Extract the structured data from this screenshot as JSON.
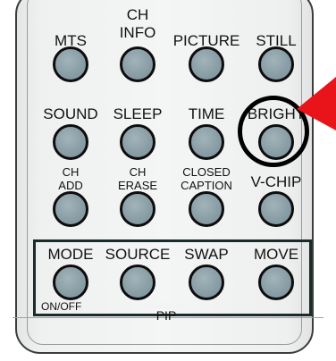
{
  "rows": [
    {
      "buttons": [
        {
          "lines": [
            "MTS"
          ]
        },
        {
          "lines": [
            "CH",
            "INFO"
          ]
        },
        {
          "lines": [
            "PICTURE"
          ]
        },
        {
          "lines": [
            "STILL"
          ]
        }
      ]
    },
    {
      "buttons": [
        {
          "lines": [
            "SOUND"
          ]
        },
        {
          "lines": [
            "SLEEP"
          ]
        },
        {
          "lines": [
            "TIME"
          ]
        },
        {
          "lines": [
            "BRIGHT"
          ]
        }
      ]
    },
    {
      "buttons": [
        {
          "lines": [
            "CH",
            "ADD"
          ]
        },
        {
          "lines": [
            "CH",
            "ERASE"
          ]
        },
        {
          "lines": [
            "CLOSED",
            "CAPTION"
          ]
        },
        {
          "lines": [
            "V-CHIP"
          ]
        }
      ]
    },
    {
      "buttons": [
        {
          "lines": [
            "MODE"
          ]
        },
        {
          "lines": [
            "SOURCE"
          ]
        },
        {
          "lines": [
            "SWAP"
          ]
        },
        {
          "lines": [
            "MOVE"
          ]
        }
      ]
    }
  ],
  "pip": {
    "label": "PIP",
    "onoff_label": "ON/OFF"
  },
  "highlighted_button": "BRIGHT",
  "colors": {
    "button_fill": "#8a9ea6",
    "arrow": "#e8141a",
    "ring": "#000000"
  }
}
